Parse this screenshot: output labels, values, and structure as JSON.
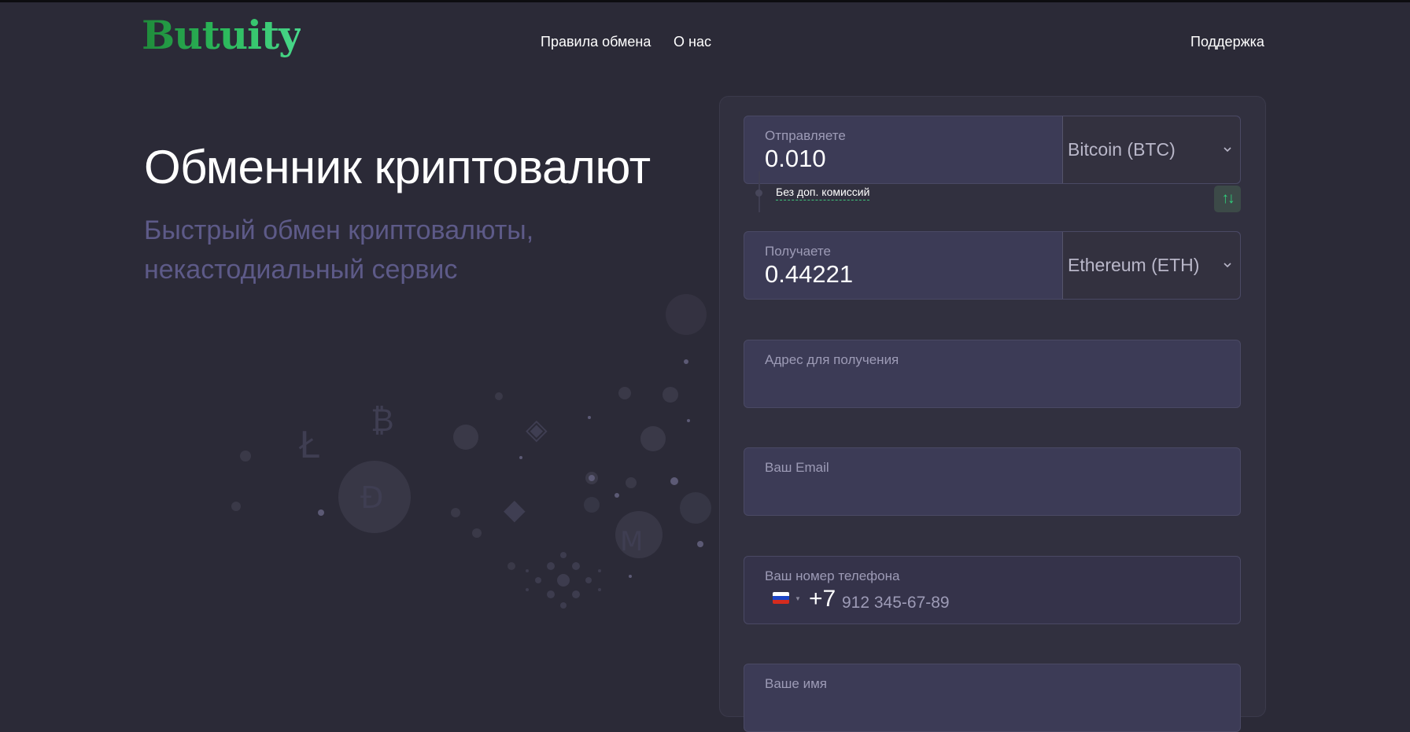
{
  "colors": {
    "background": "#2b2a37",
    "panel": "#31303f",
    "field": "#3c3b56",
    "accent_green": "#2bb85a",
    "subtitle": "#5d5a88"
  },
  "header": {
    "logo": "Butuity",
    "nav": {
      "rules": "Правила обмена",
      "about": "О нас",
      "support": "Поддержка"
    }
  },
  "hero": {
    "title": "Обменник криптовалют",
    "subtitle_line1": "Быстрый обмен криптовалюты,",
    "subtitle_line2": "некастодиальный сервис"
  },
  "exchange": {
    "send": {
      "label": "Отправляете",
      "value": "0.010",
      "currency": "Bitcoin (BTC)"
    },
    "fee_note": "Без доп. комиссий",
    "swap_icon": "swap-arrows-icon",
    "receive": {
      "label": "Получаете",
      "value": "0.44221",
      "currency": "Ethereum (ETH)"
    },
    "address": {
      "label": "Адрес для получения"
    },
    "email": {
      "label": "Ваш Email"
    },
    "phone": {
      "label": "Ваш номер телефона",
      "country_flag": "russia-flag-icon",
      "code": "+7",
      "placeholder": "912 345-67-89"
    },
    "name": {
      "label": "Ваше имя"
    }
  }
}
